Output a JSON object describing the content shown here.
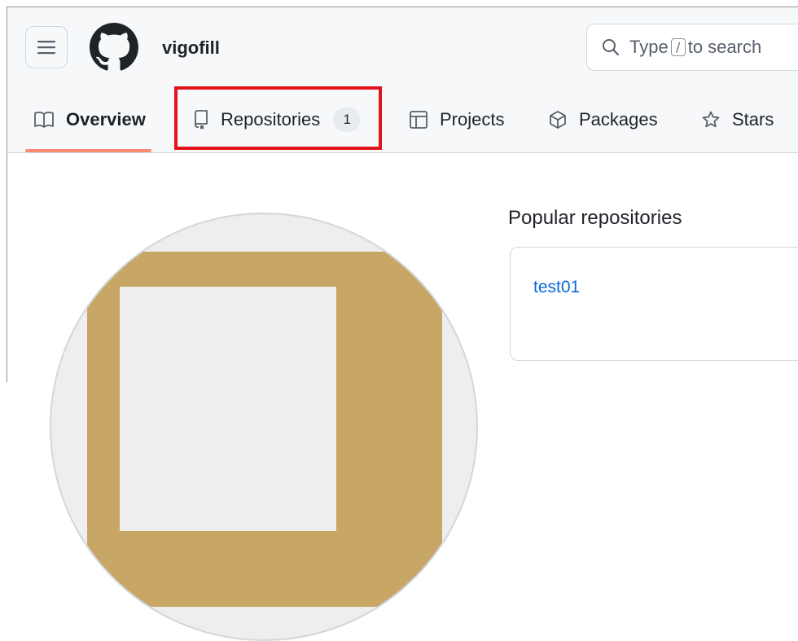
{
  "header": {
    "username": "vigofill",
    "search": {
      "prefix": "Type",
      "key": "/",
      "suffix": "to search"
    }
  },
  "tabs": [
    {
      "label": "Overview",
      "icon": "book-icon",
      "active": true
    },
    {
      "label": "Repositories",
      "icon": "repo-icon",
      "count": "1",
      "highlighted": true
    },
    {
      "label": "Projects",
      "icon": "table-icon"
    },
    {
      "label": "Packages",
      "icon": "package-icon"
    },
    {
      "label": "Stars",
      "icon": "star-icon"
    }
  ],
  "main": {
    "popular_heading": "Popular repositories",
    "repos": [
      {
        "name": "test01"
      }
    ]
  },
  "colors": {
    "highlight_border": "#e3131b",
    "active_tab_underline": "#fd8c73",
    "link": "#0969da",
    "avatar_gold": "#c8a766"
  }
}
